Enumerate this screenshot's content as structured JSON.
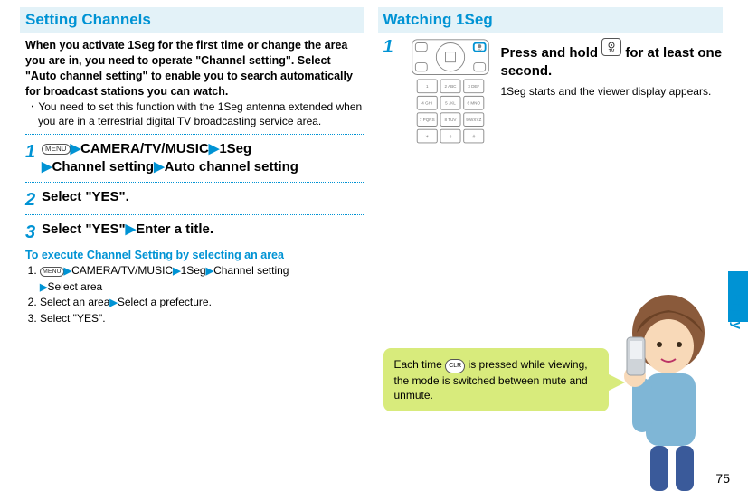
{
  "page_number": "75",
  "side_label": "Enjoy",
  "left": {
    "title": "Setting Channels",
    "intro": "When you activate 1Seg for the first time or change the area you are in, you need to operate \"Channel setting\". Select \"Auto channel setting\" to enable you to search automatically for broadcast stations you can watch.",
    "bullet": "You need to set this function with the 1Seg antenna extended when you are in a terrestrial digital TV broadcasting service area.",
    "menu_label": "MENU",
    "step1_a": "CAMERA/TV/MUSIC",
    "step1_b": "1Seg",
    "step1_c": "Channel setting",
    "step1_d": "Auto channel setting",
    "step2": "Select \"YES\".",
    "step3_a": "Select \"YES\"",
    "step3_b": "Enter a title.",
    "sub_heading": "To execute Channel Setting by selecting an area",
    "sub1_a": "CAMERA/TV/MUSIC",
    "sub1_b": "1Seg",
    "sub1_c": "Channel setting",
    "sub1_d": "Select area",
    "sub2_a": "Select an area",
    "sub2_b": "Select a prefecture.",
    "sub3": "Select \"YES\"."
  },
  "right": {
    "title": "Watching 1Seg",
    "step1_a": "Press and hold ",
    "step1_b": " for at least one second.",
    "step1_sub": "1Seg starts and the viewer display appears.",
    "tv_label": "TV",
    "speech_a": "Each time ",
    "speech_b": " is pressed while viewing, the mode is switched between mute and unmute.",
    "clr_label": "CLR"
  }
}
